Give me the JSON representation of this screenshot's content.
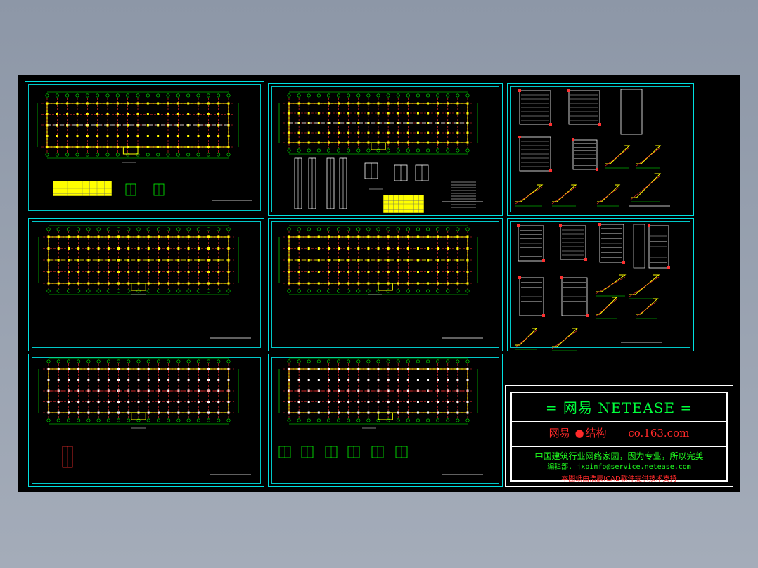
{
  "stamp": {
    "title": "= 网易  NETEASE =",
    "brand": "网易",
    "dot": "●",
    "section": "结构",
    "site": "co.163.com",
    "slogan": "中国建筑行业网络家园，因为专业，所以完美",
    "editor_label": "编辑部.",
    "editor_email": "jxpinfo@service.netease.com",
    "support": "本图纸由浩辰ICAD软件提供技术支持"
  },
  "colors": {
    "canvas": "#000000",
    "frame": "#00e0e0",
    "stamp_title": "#00ff3c",
    "stamp_red": "#ff2a2a",
    "grid_red": "#ff3030",
    "wall_yellow": "#ffff00",
    "dim_green": "#00ff00",
    "white": "#ffffff"
  }
}
